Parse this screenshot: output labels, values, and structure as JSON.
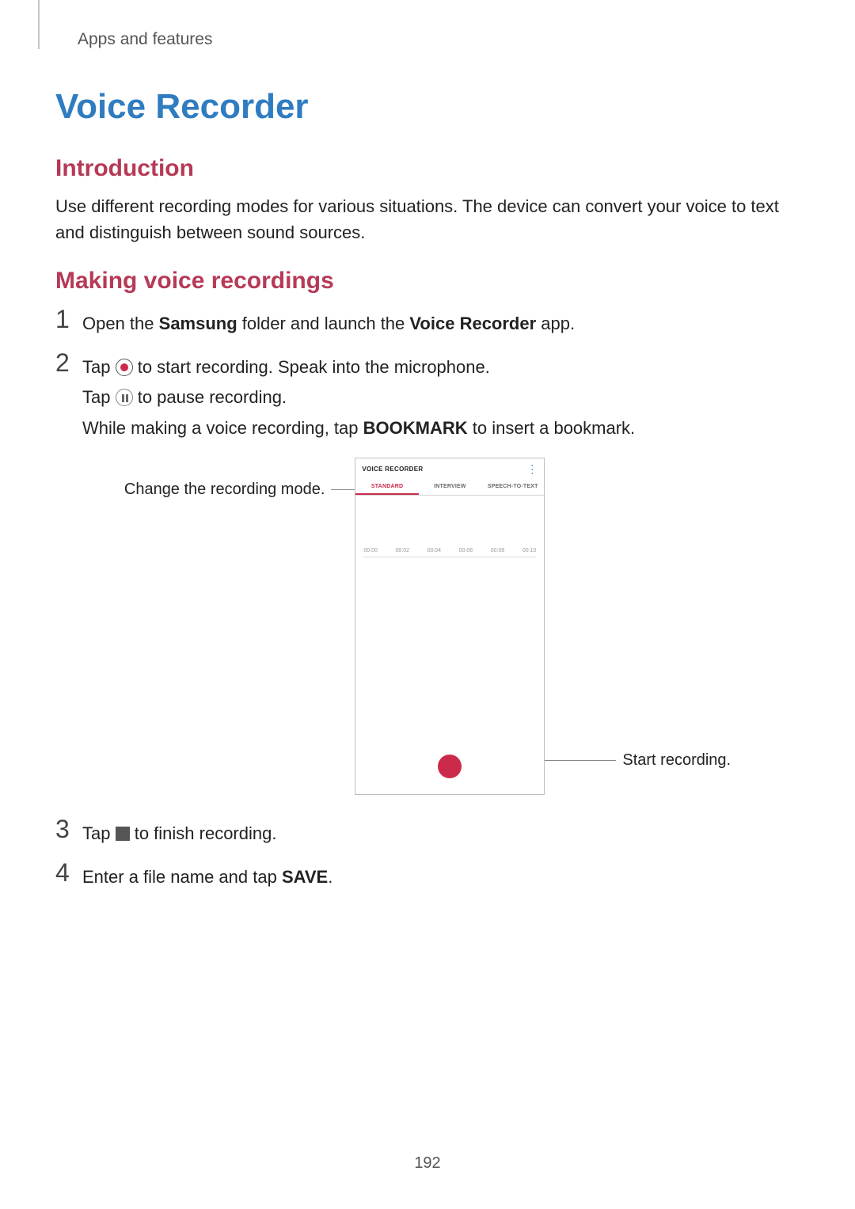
{
  "breadcrumb": "Apps and features",
  "title": "Voice Recorder",
  "section_intro": "Introduction",
  "intro_text": "Use different recording modes for various situations. The device can convert your voice to text and distinguish between sound sources.",
  "section_making": "Making voice recordings",
  "steps": {
    "s1": {
      "num": "1",
      "a": "Open the ",
      "b1": "Samsung",
      "c": " folder and launch the ",
      "b2": "Voice Recorder",
      "d": " app."
    },
    "s2": {
      "num": "2",
      "line1a": "Tap ",
      "line1b": " to start recording. Speak into the microphone.",
      "line2a": "Tap ",
      "line2b": " to pause recording.",
      "line3a": "While making a voice recording, tap ",
      "line3bold": "BOOKMARK",
      "line3b": " to insert a bookmark."
    },
    "s3": {
      "num": "3",
      "a": "Tap ",
      "b": " to finish recording."
    },
    "s4": {
      "num": "4",
      "a": "Enter a file name and tap ",
      "bold": "SAVE",
      "b": "."
    }
  },
  "callouts": {
    "left": "Change the recording mode.",
    "right": "Start recording."
  },
  "phone": {
    "title": "VOICE RECORDER",
    "menu_glyph": "⋮",
    "tabs": {
      "standard": "STANDARD",
      "interview": "INTERVIEW",
      "stt": "SPEECH-TO-TEXT"
    },
    "ticks": [
      "00:00",
      "00:02",
      "00:04",
      "00:06",
      "00:08",
      "00:10"
    ]
  },
  "page_number": "192"
}
